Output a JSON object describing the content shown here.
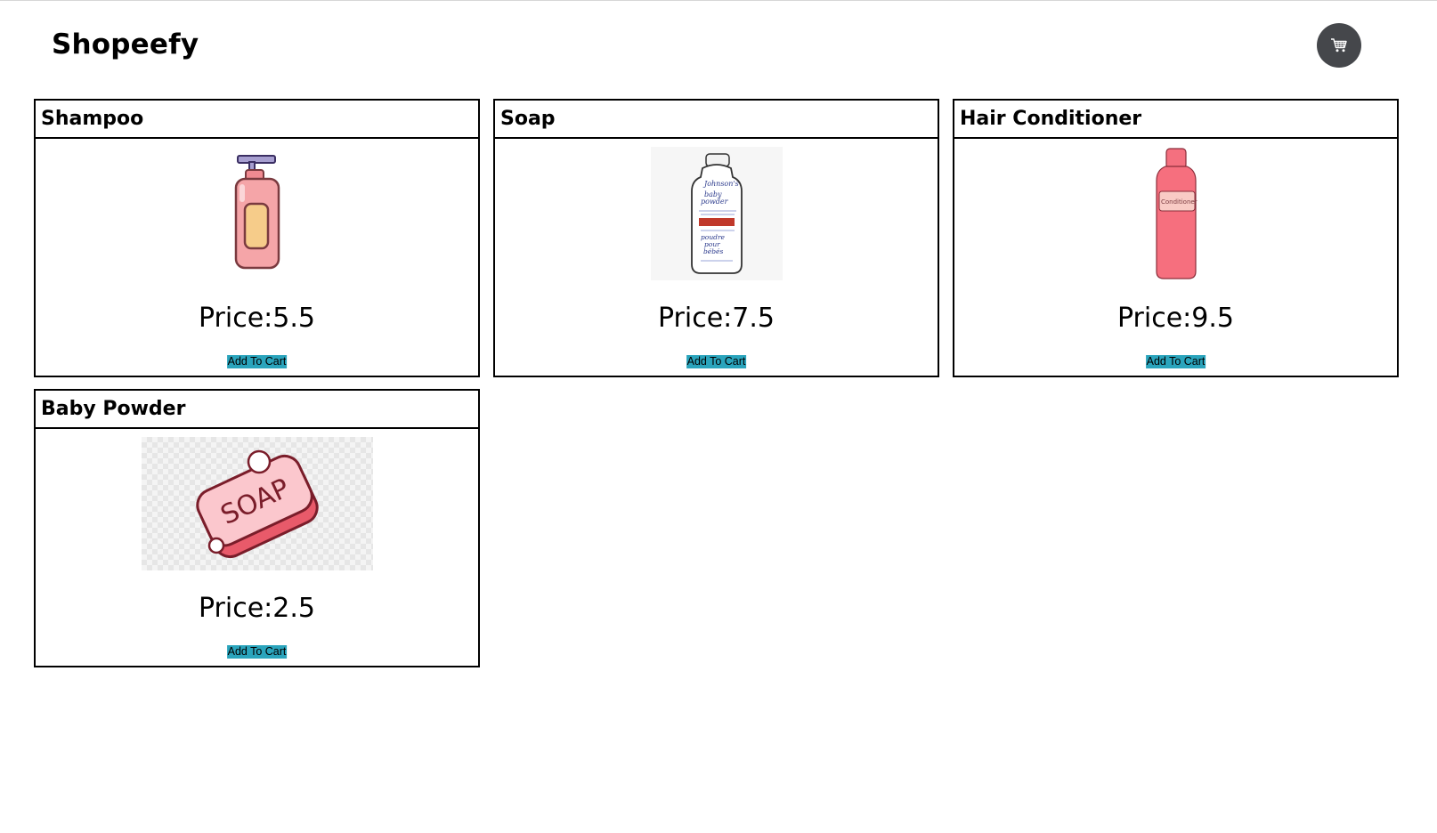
{
  "brand": {
    "title": "Shopeefy"
  },
  "header": {
    "cart_icon": "shopping-cart-icon"
  },
  "products": [
    {
      "name": "Shampoo",
      "price": "Price:5.5",
      "button_label": "Add To Cart",
      "image": "shampoo-bottle"
    },
    {
      "name": "Soap",
      "price": "Price:7.5",
      "button_label": "Add To Cart",
      "image": "baby-powder-bottle",
      "image_text": [
        "Johnson's",
        "baby",
        "powder",
        "poudre",
        "pour",
        "bébés"
      ]
    },
    {
      "name": "Hair Conditioner",
      "price": "Price:9.5",
      "button_label": "Add To Cart",
      "image": "conditioner-bottle",
      "image_text": [
        "Conditioner"
      ]
    },
    {
      "name": "Baby Powder",
      "price": "Price:2.5",
      "button_label": "Add To Cart",
      "image": "soap-bar",
      "image_text": [
        "SOAP"
      ]
    }
  ],
  "colors": {
    "button_bg": "#2aa4bc",
    "cart_button_bg": "#45474b",
    "border": "#000000"
  }
}
